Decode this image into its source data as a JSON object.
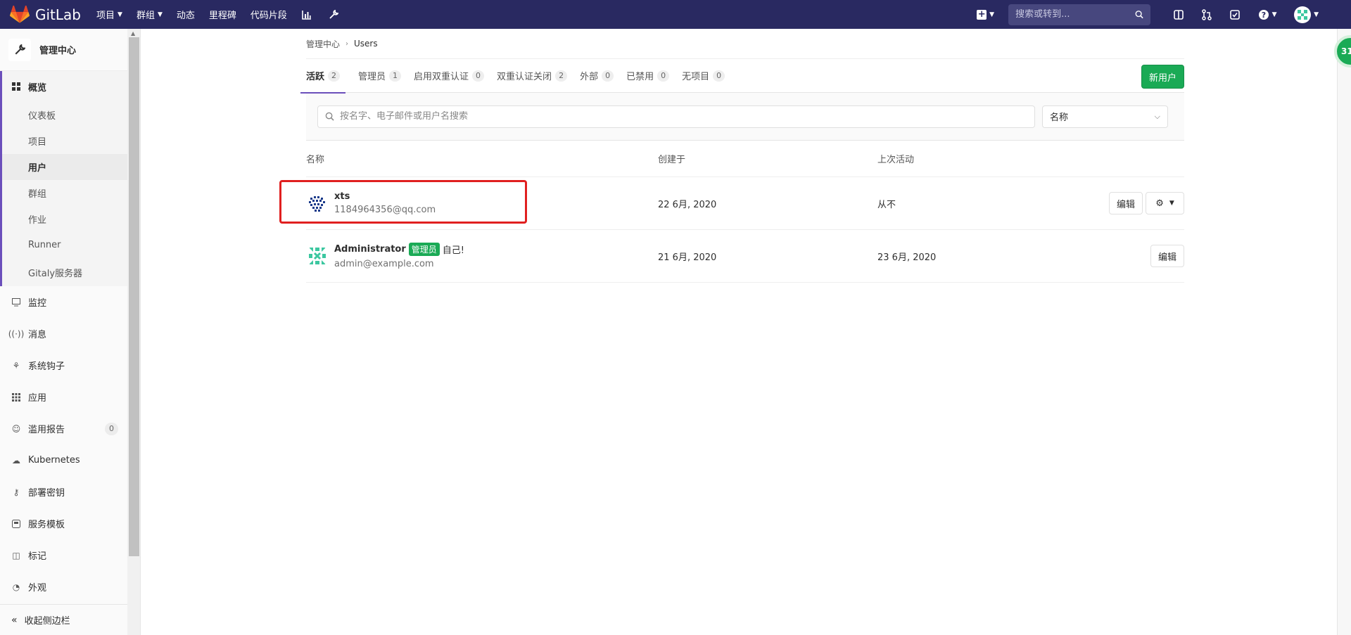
{
  "topnav": {
    "brand": "GitLab",
    "links": [
      {
        "label": "项目",
        "caret": true
      },
      {
        "label": "群组",
        "caret": true
      },
      {
        "label": "动态",
        "caret": false
      },
      {
        "label": "里程碑",
        "caret": false
      },
      {
        "label": "代码片段",
        "caret": false
      }
    ],
    "search_placeholder": "搜索或转到..."
  },
  "sidebar": {
    "title": "管理中心",
    "overview_label": "概览",
    "sub_items": [
      "仪表板",
      "项目",
      "用户",
      "群组",
      "作业",
      "Runner",
      "Gitaly服务器"
    ],
    "active_sub": "用户",
    "items": [
      {
        "label": "监控",
        "icon": "monitor-icon"
      },
      {
        "label": "消息",
        "icon": "broadcast-icon"
      },
      {
        "label": "系统钩子",
        "icon": "hook-icon"
      },
      {
        "label": "应用",
        "icon": "apps-icon"
      },
      {
        "label": "滥用报告",
        "icon": "emoji-icon",
        "count": "0"
      },
      {
        "label": "Kubernetes",
        "icon": "cloud-icon"
      },
      {
        "label": "部署密钥",
        "icon": "key-icon"
      },
      {
        "label": "服务模板",
        "icon": "template-icon"
      },
      {
        "label": "标记",
        "icon": "label-icon"
      },
      {
        "label": "外观",
        "icon": "palette-icon"
      }
    ],
    "collapse_label": "收起侧边栏"
  },
  "breadcrumb": {
    "parent": "管理中心",
    "current": "Users"
  },
  "tabs": [
    {
      "label": "活跃",
      "count": "2",
      "active": true
    },
    {
      "label": "管理员",
      "count": "1"
    },
    {
      "label": "启用双重认证",
      "count": "0"
    },
    {
      "label": "双重认证关闭",
      "count": "2"
    },
    {
      "label": "外部",
      "count": "0"
    },
    {
      "label": "已禁用",
      "count": "0"
    },
    {
      "label": "无项目",
      "count": "0"
    }
  ],
  "new_user_label": "新用户",
  "filter": {
    "placeholder": "按名字、电子邮件或用户名搜索",
    "sort_value": "名称"
  },
  "table": {
    "headers": {
      "name": "名称",
      "created": "创建于",
      "last": "上次活动"
    },
    "rows": [
      {
        "name": "xts",
        "email": "1184964356@qq.com",
        "created": "22 6月, 2020",
        "last": "从不",
        "edit": "编辑"
      },
      {
        "name": "Administrator",
        "badge": "管理员",
        "self": "自己!",
        "email": "admin@example.com",
        "created": "21 6月, 2020",
        "last": "23 6月, 2020",
        "edit": "编辑"
      }
    ]
  },
  "float_badge": "31",
  "colors": {
    "nav": "#292961",
    "accent": "#6b4fbb",
    "success": "#1aaa55",
    "highlight": "#e02020"
  }
}
